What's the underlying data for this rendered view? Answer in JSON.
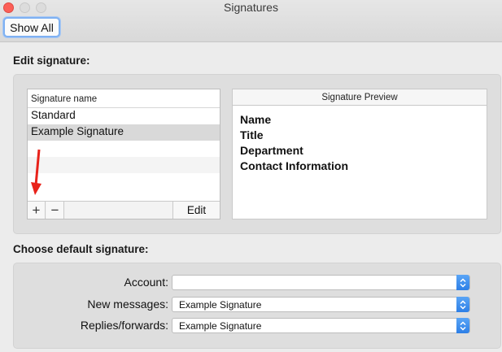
{
  "window": {
    "title": "Signatures"
  },
  "toolbar": {
    "show_all_label": "Show All"
  },
  "edit_section": {
    "heading": "Edit signature:",
    "list_header": "Signature name",
    "signatures": [
      "Standard",
      "Example Signature"
    ],
    "selected_index": 1,
    "edit_label": "Edit",
    "add_symbol": "+",
    "remove_symbol": "−"
  },
  "preview": {
    "header": "Signature Preview",
    "lines": [
      "Name",
      "Title",
      "Department",
      "Contact Information"
    ]
  },
  "default_section": {
    "heading": "Choose default signature:",
    "account_label": "Account:",
    "account_value": "",
    "new_messages_label": "New messages:",
    "new_messages_value": "Example Signature",
    "replies_label": "Replies/forwards:",
    "replies_value": "Example Signature"
  },
  "colors": {
    "accent": "#2d7fe6",
    "annotation_arrow": "#e8221a",
    "close_button": "#fc5f57"
  },
  "icons": [
    "close-icon",
    "minimize-icon",
    "zoom-icon",
    "plus-icon",
    "minus-icon",
    "chevron-updown-icon",
    "annotation-arrow-icon"
  ]
}
